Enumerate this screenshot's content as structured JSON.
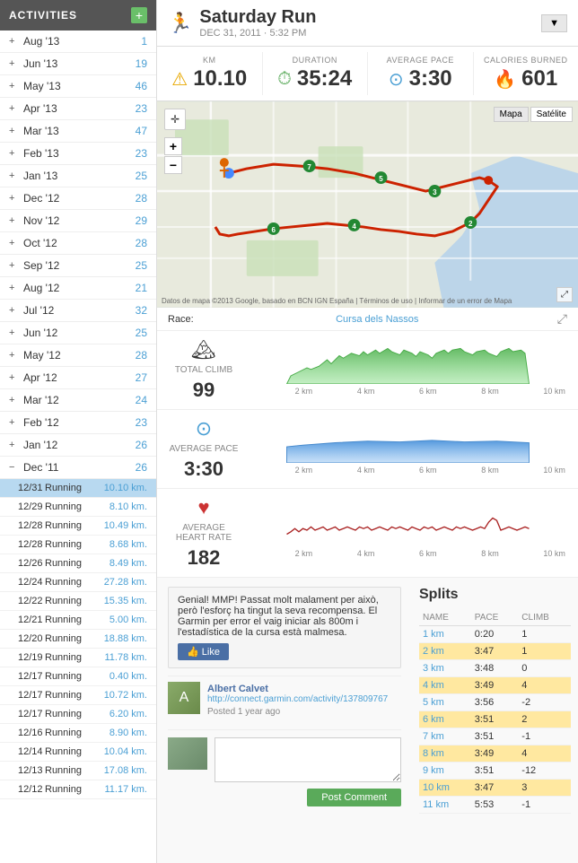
{
  "sidebar": {
    "header": "ACTIVITIES",
    "add_button": "+",
    "months": [
      {
        "label": "Aug '13",
        "count": 1,
        "expanded": false
      },
      {
        "label": "Jun '13",
        "count": 19,
        "expanded": false
      },
      {
        "label": "May '13",
        "count": 46,
        "expanded": false
      },
      {
        "label": "Apr '13",
        "count": 23,
        "expanded": false
      },
      {
        "label": "Mar '13",
        "count": 47,
        "expanded": false
      },
      {
        "label": "Feb '13",
        "count": 23,
        "expanded": false
      },
      {
        "label": "Jan '13",
        "count": 25,
        "expanded": false
      },
      {
        "label": "Dec '12",
        "count": 28,
        "expanded": false
      },
      {
        "label": "Nov '12",
        "count": 29,
        "expanded": false
      },
      {
        "label": "Oct '12",
        "count": 28,
        "expanded": false
      },
      {
        "label": "Sep '12",
        "count": 25,
        "expanded": false
      },
      {
        "label": "Aug '12",
        "count": 21,
        "expanded": false
      },
      {
        "label": "Jul '12",
        "count": 32,
        "expanded": false
      },
      {
        "label": "Jun '12",
        "count": 25,
        "expanded": false
      },
      {
        "label": "May '12",
        "count": 28,
        "expanded": false
      },
      {
        "label": "Apr '12",
        "count": 27,
        "expanded": false
      },
      {
        "label": "Mar '12",
        "count": 24,
        "expanded": false
      },
      {
        "label": "Feb '12",
        "count": 23,
        "expanded": false
      },
      {
        "label": "Jan '12",
        "count": 26,
        "expanded": false
      },
      {
        "label": "Dec '11",
        "count": 26,
        "expanded": true
      }
    ],
    "activities": [
      {
        "date": "12/31",
        "type": "Running",
        "dist": "10.10 km.",
        "active": true
      },
      {
        "date": "12/29",
        "type": "Running",
        "dist": "8.10 km.",
        "active": false
      },
      {
        "date": "12/28",
        "type": "Running",
        "dist": "10.49 km.",
        "active": false
      },
      {
        "date": "12/28",
        "type": "Running",
        "dist": "8.68 km.",
        "active": false
      },
      {
        "date": "12/26",
        "type": "Running",
        "dist": "8.49 km.",
        "active": false
      },
      {
        "date": "12/24",
        "type": "Running",
        "dist": "27.28 km.",
        "active": false
      },
      {
        "date": "12/22",
        "type": "Running",
        "dist": "15.35 km.",
        "active": false
      },
      {
        "date": "12/21",
        "type": "Running",
        "dist": "5.00 km.",
        "active": false
      },
      {
        "date": "12/20",
        "type": "Running",
        "dist": "18.88 km.",
        "active": false
      },
      {
        "date": "12/19",
        "type": "Running",
        "dist": "11.78 km.",
        "active": false
      },
      {
        "date": "12/17",
        "type": "Running",
        "dist": "0.40 km.",
        "active": false
      },
      {
        "date": "12/17",
        "type": "Running",
        "dist": "10.72 km.",
        "active": false
      },
      {
        "date": "12/17",
        "type": "Running",
        "dist": "6.20 km.",
        "active": false
      },
      {
        "date": "12/16",
        "type": "Running",
        "dist": "8.90 km.",
        "active": false
      },
      {
        "date": "12/14",
        "type": "Running",
        "dist": "10.04 km.",
        "active": false
      },
      {
        "date": "12/13",
        "type": "Running",
        "dist": "17.08 km.",
        "active": false
      },
      {
        "date": "12/12",
        "type": "Running",
        "dist": "11.17 km.",
        "active": false
      }
    ]
  },
  "activity": {
    "title": "Saturday Run",
    "date": "DEC 31, 2011 · 5:32 PM",
    "icon": "🏃",
    "stats": {
      "km_label": "KM",
      "km_value": "10.10",
      "duration_label": "DURATION",
      "duration_value": "35:24",
      "pace_label": "AVERAGE PACE",
      "pace_value": "3:30",
      "calories_label": "CALORIES BURNED",
      "calories_value": "601"
    },
    "map": {
      "btn_map": "Mapa",
      "btn_satellite": "Satélite"
    },
    "race": {
      "label": "Race:",
      "name": "Cursa dels Nassos"
    },
    "charts": {
      "climb": {
        "label": "TOTAL CLIMB",
        "value": "99",
        "x_labels": [
          "2 km",
          "4 km",
          "6 km",
          "8 km",
          "10 km"
        ]
      },
      "pace": {
        "label": "AVERAGE PACE",
        "value": "3:30",
        "x_labels": [
          "2 km",
          "4 km",
          "6 km",
          "8 km",
          "10 km"
        ]
      },
      "heart": {
        "label": "AVERAGE HEART RATE",
        "value": "182",
        "x_labels": [
          "2 km",
          "4 km",
          "6 km",
          "8 km",
          "10 km"
        ]
      }
    }
  },
  "comments": {
    "main_comment": "Genial! MMP! Passat molt malament per això, però l'esforç ha tingut la seva recompensa. El Garmin per error el vaig iniciar als 800m i l'estadística de la cursa està malmesa.",
    "like_btn": "👍 Like",
    "user": {
      "name": "Albert Calvet",
      "link": "http://connect.garmin.com/activity/137809767",
      "time": "Posted 1 year ago"
    },
    "post_btn": "Post Comment",
    "textarea_placeholder": ""
  },
  "splits": {
    "title": "Splits",
    "headers": [
      "NAME",
      "PACE",
      "CLIMB"
    ],
    "rows": [
      {
        "name": "1 km",
        "pace": "0:20",
        "climb": "1",
        "highlight": false
      },
      {
        "name": "2 km",
        "pace": "3:47",
        "climb": "1",
        "highlight": true
      },
      {
        "name": "3 km",
        "pace": "3:48",
        "climb": "0",
        "highlight": false
      },
      {
        "name": "4 km",
        "pace": "3:49",
        "climb": "4",
        "highlight": true
      },
      {
        "name": "5 km",
        "pace": "3:56",
        "climb": "-2",
        "highlight": false
      },
      {
        "name": "6 km",
        "pace": "3:51",
        "climb": "2",
        "highlight": true
      },
      {
        "name": "7 km",
        "pace": "3:51",
        "climb": "-1",
        "highlight": false
      },
      {
        "name": "8 km",
        "pace": "3:49",
        "climb": "4",
        "highlight": true
      },
      {
        "name": "9 km",
        "pace": "3:51",
        "climb": "-12",
        "highlight": false
      },
      {
        "name": "10 km",
        "pace": "3:47",
        "climb": "3",
        "highlight": true
      },
      {
        "name": "11 km",
        "pace": "5:53",
        "climb": "-1",
        "highlight": false
      }
    ]
  }
}
